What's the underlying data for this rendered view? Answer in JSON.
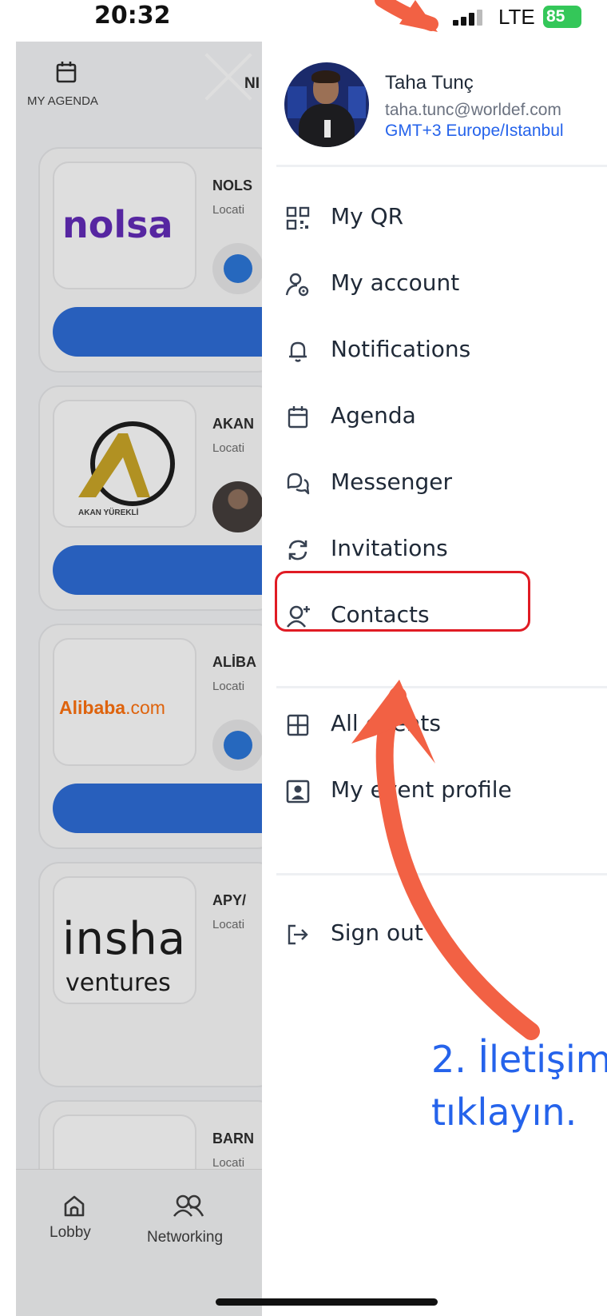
{
  "status_bar": {
    "time": "20:32",
    "network": "LTE",
    "battery": "85"
  },
  "background_app": {
    "agenda_label": "MY AGENDA",
    "tab_partial": "NI",
    "cards": [
      {
        "name": "NOLS",
        "location": "Locati",
        "logo_text": "nolsa"
      },
      {
        "name": "AKAN",
        "location": "Locati",
        "logo_text": "AKAN YÜREKLİ"
      },
      {
        "name": "ALİBA",
        "location": "Locati",
        "logo_text": "Alibaba",
        "logo_suffix": ".com"
      },
      {
        "name": "APY/",
        "location": "Locati",
        "logo_line1": "insha",
        "logo_line2": "ventures"
      },
      {
        "name": "BARN",
        "location": "Locati"
      }
    ],
    "nav": {
      "lobby": "Lobby",
      "networking": "Networking"
    }
  },
  "drawer": {
    "profile": {
      "name": "Taha Tunç",
      "email": "taha.tunc@worldef.com",
      "timezone": "GMT+3 Europe/Istanbul"
    },
    "menu": [
      {
        "label": "My QR",
        "icon": "qr-code-icon"
      },
      {
        "label": "My account",
        "icon": "user-settings-icon"
      },
      {
        "label": "Notifications",
        "icon": "bell-icon"
      },
      {
        "label": "Agenda",
        "icon": "calendar-icon"
      },
      {
        "label": "Messenger",
        "icon": "chat-bubbles-icon"
      },
      {
        "label": "Invitations",
        "icon": "refresh-arrows-icon"
      },
      {
        "label": "Contacts",
        "icon": "add-contact-icon"
      }
    ],
    "secondary_menu": [
      {
        "label": "All events",
        "icon": "grid-plus-icon"
      },
      {
        "label": "My event profile",
        "icon": "profile-card-icon"
      }
    ],
    "sign_out": {
      "label": "Sign out",
      "icon": "sign-out-icon"
    }
  },
  "annotation": {
    "line1": "2. İletişim",
    "line2": "tıklayın.",
    "color": "#2563eb",
    "arrow_color": "#f26144",
    "highlight_color": "#e01b24"
  }
}
